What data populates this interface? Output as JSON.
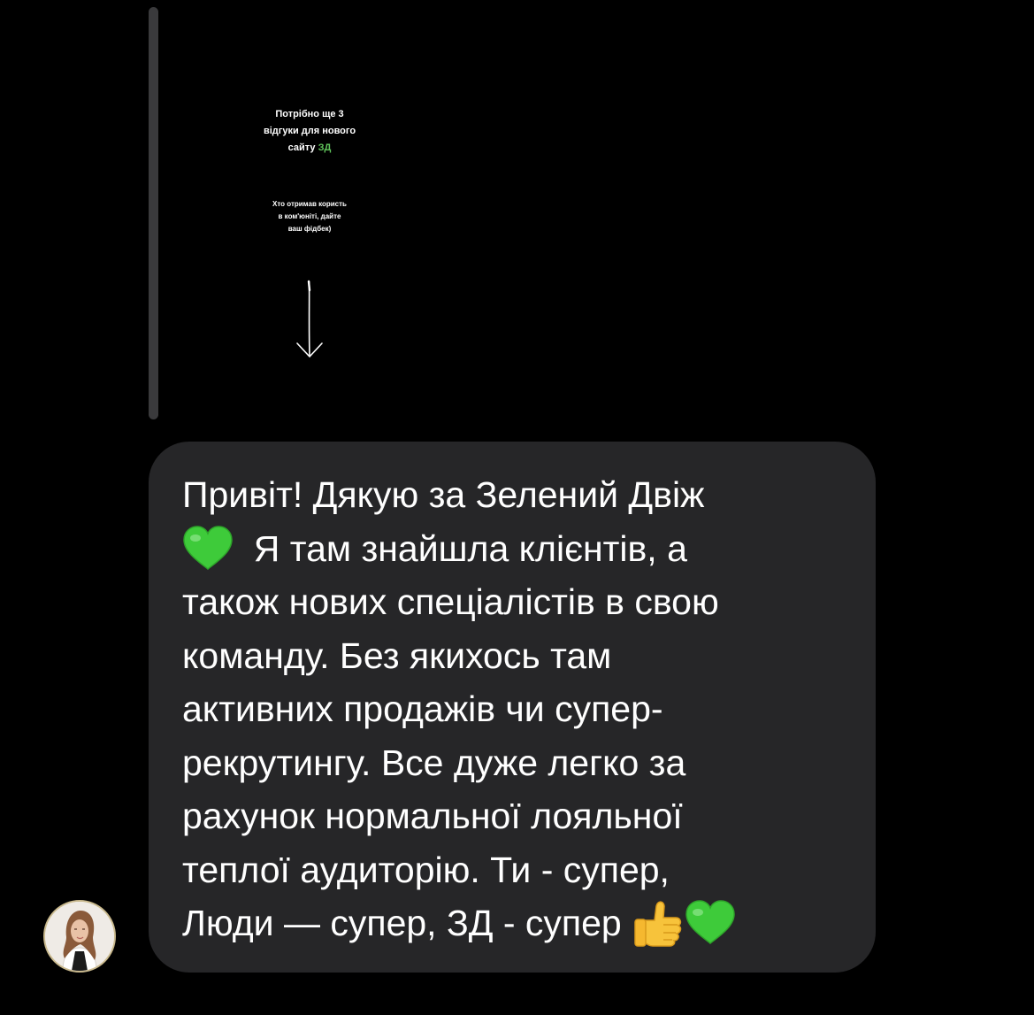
{
  "story_reply": {
    "heading_lines": [
      "Потрібно ще 3",
      "відгуки для нового"
    ],
    "heading_last_prefix": "сайту ",
    "heading_accent": "ЗД",
    "subtext_lines": [
      "Хто отримав користь",
      "в ком'юніті, дайте",
      "ваш фідбек)"
    ],
    "accent_color": "#5fc25a"
  },
  "message": {
    "lines": [
      "Привіт! Дякую за Зелений Двіж",
      "Я там знайшла клієнтів, а",
      "також нових спеціалістів в свою",
      "команду. Без якихось там",
      "активних продажів чи супер-",
      "рекрутингу. Все дуже легко за",
      "рахунок нормальної лояльної",
      "теплої аудиторію. Ти - супер,",
      "Люди — супер, ЗД - супер"
    ],
    "emojis": {
      "line2_start": "green-heart",
      "line9_end": [
        "thumbs-up",
        "green-heart"
      ]
    },
    "bubble_color": "#262628"
  },
  "sender": {
    "avatar_icon": "user-avatar-photo"
  }
}
